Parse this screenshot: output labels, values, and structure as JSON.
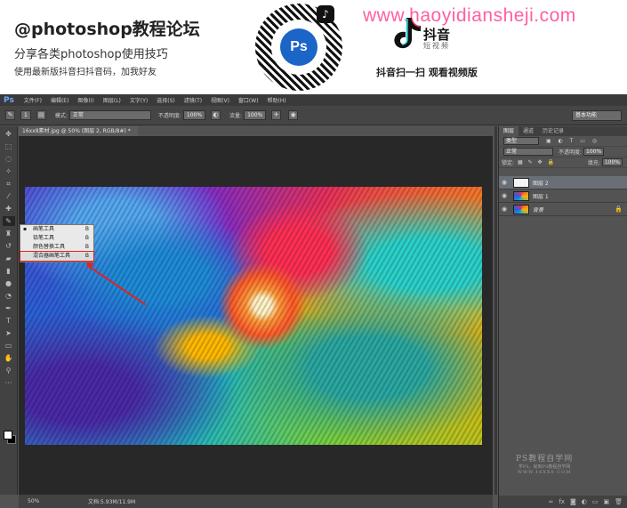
{
  "promo": {
    "title": "@photoshop教程论坛",
    "subtitle": "分享各类photoshop使用技巧",
    "small": "使用最新版抖音扫抖音码，加我好友",
    "ps_logo": "Ps",
    "url": "www.haoyidiansheji.com",
    "douyin_name": "抖音",
    "douyin_sub": "短视频",
    "caption": "抖音扫一扫 观看视频版"
  },
  "menubar": {
    "logo": "Ps",
    "items": [
      "文件(F)",
      "编辑(E)",
      "图像(I)",
      "图层(L)",
      "文字(Y)",
      "选择(S)",
      "滤镜(T)",
      "视图(V)",
      "窗口(W)",
      "帮助(H)"
    ]
  },
  "options": {
    "mode_label": "模式:",
    "mode_value": "正常",
    "opacity_label": "不透明度:",
    "opacity_value": "100%",
    "flow_label": "流量:",
    "flow_value": "100%",
    "brush_size": "1",
    "workspace": "基本功能"
  },
  "document": {
    "tab": "16xx8素材.jpg @ 50% (图层 2, RGB/8#) *",
    "zoom": "50%",
    "doc_size": "文档:5.93M/11.9M"
  },
  "flyout": {
    "items": [
      {
        "label": "画笔工具",
        "key": "B"
      },
      {
        "label": "铅笔工具",
        "key": "B"
      },
      {
        "label": "颜色替换工具",
        "key": "B"
      },
      {
        "label": "混合器画笔工具",
        "key": "B"
      }
    ]
  },
  "panel": {
    "tabs": [
      "图层",
      "通道",
      "历史记录"
    ],
    "kind": "类型",
    "blend": "正常",
    "opacity_label": "不透明度:",
    "opacity_value": "100%",
    "lock_label": "锁定:",
    "fill_label": "填充:",
    "fill_value": "100%",
    "layers": [
      "图层 2",
      "图层 1",
      "背景"
    ]
  },
  "watermark": {
    "line1": "PS教程自学网",
    "line2": "学PS，就到PS教程自学网",
    "line3": "WWW.16XX8.COM"
  }
}
